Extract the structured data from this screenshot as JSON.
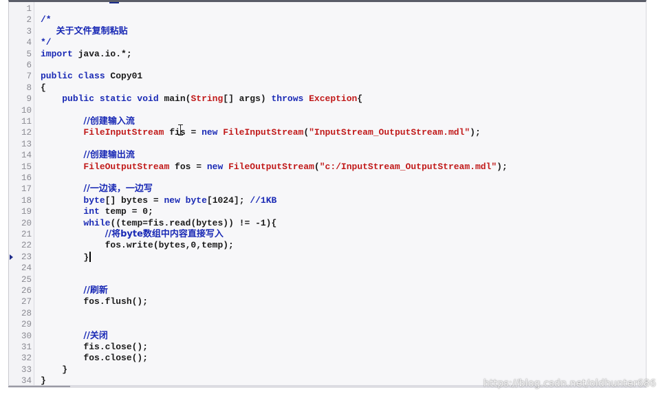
{
  "colors": {
    "keyword": "#1a2ab5",
    "class_and_string": "#c11a1a",
    "comment": "#1a2ab5",
    "plain": "#1b1b1b",
    "line_number": "#8a8a92",
    "editor_background": "#f7f7f9"
  },
  "editor": {
    "marker_line": 23,
    "caret_line": 23,
    "lines": [
      {
        "n": "1",
        "tokens": []
      },
      {
        "n": "2",
        "tokens": [
          {
            "t": "cmt",
            "v": "/*"
          }
        ]
      },
      {
        "n": "3",
        "tokens": [
          {
            "t": "cmt",
            "v": "     关于文件复制粘贴"
          }
        ]
      },
      {
        "n": "4",
        "tokens": [
          {
            "t": "cmt",
            "v": "*/"
          }
        ]
      },
      {
        "n": "5",
        "tokens": [
          {
            "t": "kw",
            "v": "import"
          },
          {
            "t": "plain",
            "v": " java.io.*;"
          }
        ]
      },
      {
        "n": "6",
        "tokens": []
      },
      {
        "n": "7",
        "tokens": [
          {
            "t": "kw",
            "v": "public class"
          },
          {
            "t": "plain",
            "v": " Copy01"
          }
        ]
      },
      {
        "n": "8",
        "tokens": [
          {
            "t": "plain",
            "v": "{"
          }
        ]
      },
      {
        "n": "9",
        "tokens": [
          {
            "t": "plain",
            "v": "    "
          },
          {
            "t": "kw",
            "v": "public static void"
          },
          {
            "t": "plain",
            "v": " main("
          },
          {
            "t": "cls",
            "v": "String"
          },
          {
            "t": "plain",
            "v": "[] args) "
          },
          {
            "t": "kw",
            "v": "throws"
          },
          {
            "t": "plain",
            "v": " "
          },
          {
            "t": "cls",
            "v": "Exception"
          },
          {
            "t": "plain",
            "v": "{"
          }
        ]
      },
      {
        "n": "10",
        "tokens": []
      },
      {
        "n": "11",
        "tokens": [
          {
            "t": "plain",
            "v": "        "
          },
          {
            "t": "cmt",
            "v": "//创建输入流"
          }
        ]
      },
      {
        "n": "12",
        "tokens": [
          {
            "t": "plain",
            "v": "        "
          },
          {
            "t": "cls",
            "v": "FileInputStream"
          },
          {
            "t": "plain",
            "v": " fis = "
          },
          {
            "t": "kw",
            "v": "new"
          },
          {
            "t": "plain",
            "v": " "
          },
          {
            "t": "cls",
            "v": "FileInputStream"
          },
          {
            "t": "plain",
            "v": "("
          },
          {
            "t": "str",
            "v": "\"InputStream_OutputStream.mdl\""
          },
          {
            "t": "plain",
            "v": ");"
          }
        ]
      },
      {
        "n": "13",
        "tokens": []
      },
      {
        "n": "14",
        "tokens": [
          {
            "t": "plain",
            "v": "        "
          },
          {
            "t": "cmt",
            "v": "//创建输出流"
          }
        ]
      },
      {
        "n": "15",
        "tokens": [
          {
            "t": "plain",
            "v": "        "
          },
          {
            "t": "cls",
            "v": "FileOutputStream"
          },
          {
            "t": "plain",
            "v": " fos = "
          },
          {
            "t": "kw",
            "v": "new"
          },
          {
            "t": "plain",
            "v": " "
          },
          {
            "t": "cls",
            "v": "FileOutputStream"
          },
          {
            "t": "plain",
            "v": "("
          },
          {
            "t": "str",
            "v": "\"c:/InputStream_OutputStream.mdl\""
          },
          {
            "t": "plain",
            "v": ");"
          }
        ]
      },
      {
        "n": "16",
        "tokens": []
      },
      {
        "n": "17",
        "tokens": [
          {
            "t": "plain",
            "v": "        "
          },
          {
            "t": "cmt",
            "v": "//一边读，一边写"
          }
        ]
      },
      {
        "n": "18",
        "tokens": [
          {
            "t": "plain",
            "v": "        "
          },
          {
            "t": "kw",
            "v": "byte"
          },
          {
            "t": "plain",
            "v": "[] bytes = "
          },
          {
            "t": "kw",
            "v": "new byte"
          },
          {
            "t": "plain",
            "v": "[1024]; "
          },
          {
            "t": "cmt",
            "v": "//1KB"
          }
        ]
      },
      {
        "n": "19",
        "tokens": [
          {
            "t": "plain",
            "v": "        "
          },
          {
            "t": "kw",
            "v": "int"
          },
          {
            "t": "plain",
            "v": " temp = 0;"
          }
        ]
      },
      {
        "n": "20",
        "tokens": [
          {
            "t": "plain",
            "v": "        "
          },
          {
            "t": "kw",
            "v": "while"
          },
          {
            "t": "plain",
            "v": "((temp=fis.read(bytes)) != -1){"
          }
        ]
      },
      {
        "n": "21",
        "tokens": [
          {
            "t": "plain",
            "v": "            "
          },
          {
            "t": "cmt",
            "v": "//将byte数组中内容直接写入"
          }
        ]
      },
      {
        "n": "22",
        "tokens": [
          {
            "t": "plain",
            "v": "            fos.write(bytes,0,temp);"
          }
        ]
      },
      {
        "n": "23",
        "tokens": [
          {
            "t": "plain",
            "v": "        }"
          }
        ]
      },
      {
        "n": "24",
        "tokens": []
      },
      {
        "n": "25",
        "tokens": []
      },
      {
        "n": "26",
        "tokens": [
          {
            "t": "plain",
            "v": "        "
          },
          {
            "t": "cmt",
            "v": "//刷新"
          }
        ]
      },
      {
        "n": "27",
        "tokens": [
          {
            "t": "plain",
            "v": "        fos.flush();"
          }
        ]
      },
      {
        "n": "28",
        "tokens": []
      },
      {
        "n": "29",
        "tokens": []
      },
      {
        "n": "30",
        "tokens": [
          {
            "t": "plain",
            "v": "        "
          },
          {
            "t": "cmt",
            "v": "//关闭"
          }
        ]
      },
      {
        "n": "31",
        "tokens": [
          {
            "t": "plain",
            "v": "        fis.close();"
          }
        ]
      },
      {
        "n": "32",
        "tokens": [
          {
            "t": "plain",
            "v": "        fos.close();"
          }
        ]
      },
      {
        "n": "33",
        "tokens": [
          {
            "t": "plain",
            "v": "    }"
          }
        ]
      },
      {
        "n": "34",
        "tokens": [
          {
            "t": "plain",
            "v": "}"
          }
        ]
      }
    ]
  },
  "watermark": "https://blog.csdn.net/oldhunter686"
}
